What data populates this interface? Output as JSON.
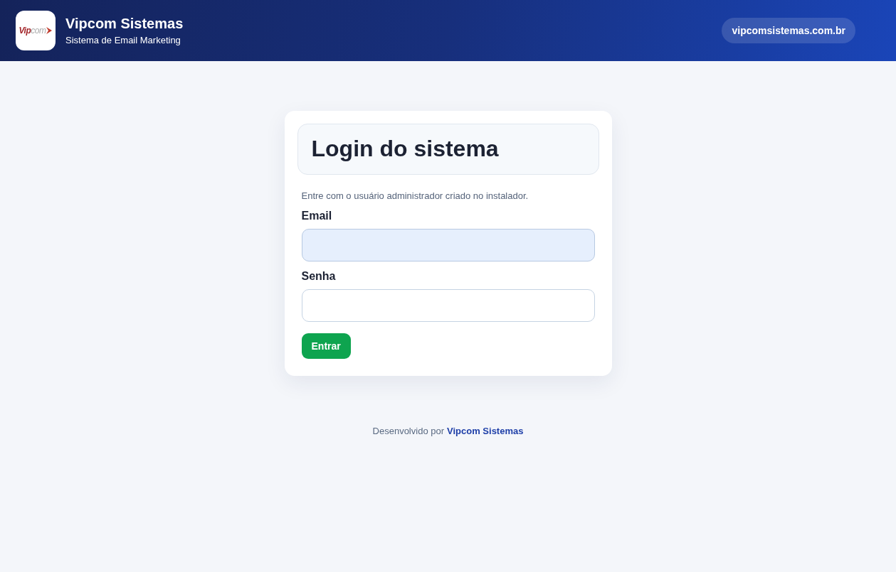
{
  "header": {
    "logo": "**Vip**com",
    "title": "Vipcom Sistemas",
    "subtitle": "Sistema de Email Marketing",
    "site_link": "vipcomsistemas.com.br"
  },
  "login_card": {
    "title": "Login do sistema",
    "hint": "Entre com o usuário administrador criado no instalador.",
    "fields": [
      {
        "label": "Email",
        "autofilled": true
      },
      {
        "label": "Senha",
        "autofilled": false
      }
    ],
    "submit_button": "Entrar"
  },
  "footer": {
    "text": "Desenvolvido por",
    "link": "Vipcom Sistemas"
  }
}
